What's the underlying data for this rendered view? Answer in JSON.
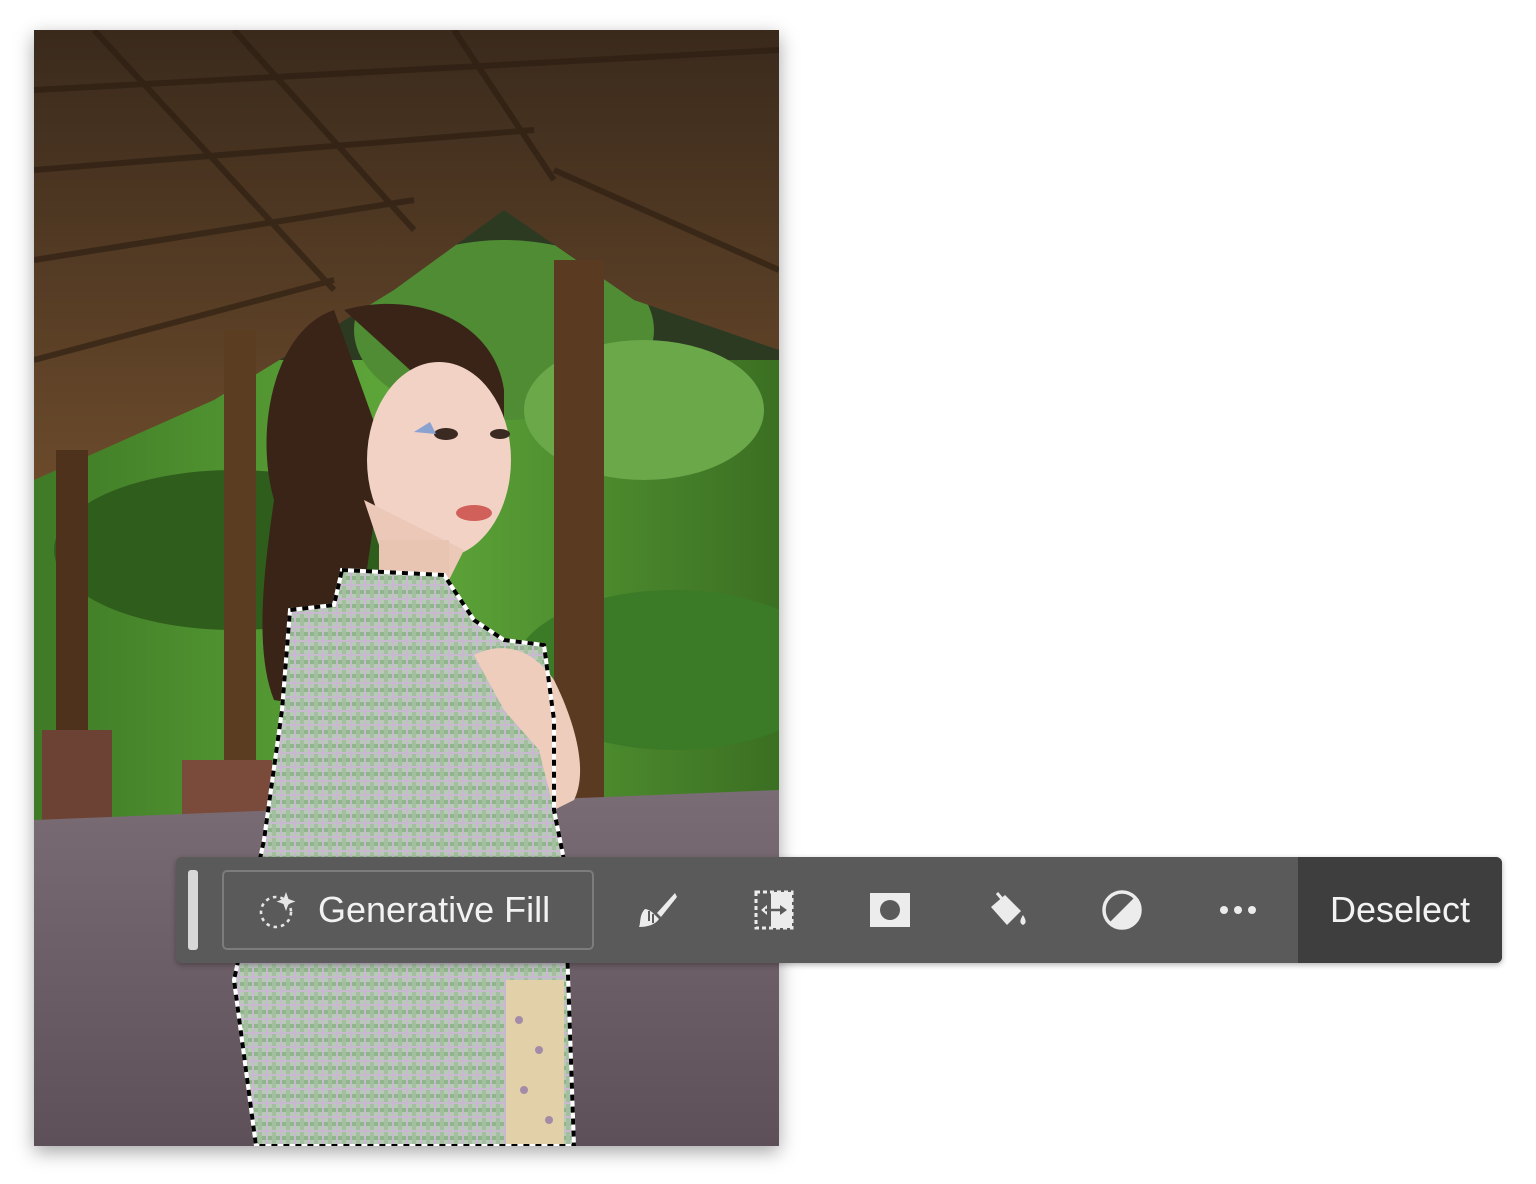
{
  "canvas": {
    "image_description_icon": "photo-portrait"
  },
  "taskbar": {
    "generative_fill_label": "Generative Fill",
    "generative_fill_icon": "sparkle-lasso-icon",
    "tools": [
      {
        "name": "brush-icon"
      },
      {
        "name": "transform-selection-icon"
      },
      {
        "name": "mask-icon"
      },
      {
        "name": "fill-bucket-icon"
      },
      {
        "name": "adjustment-icon"
      },
      {
        "name": "more-options-icon"
      }
    ],
    "deselect_label": "Deselect"
  },
  "colors": {
    "taskbar_bg": "#5a5a5a",
    "deselect_bg": "#3e3e3e",
    "text": "#f2f2f2"
  }
}
